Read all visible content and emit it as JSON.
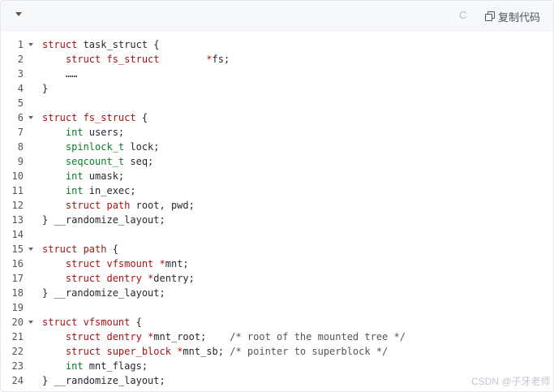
{
  "toolbar": {
    "language_label": "C",
    "copy_label": "复制代码",
    "copy_icon": "copy-icon",
    "collapse_icon": "chevron-down-icon"
  },
  "code_lines": [
    {
      "n": "1",
      "fold": true,
      "parts": [
        {
          "t": "struct",
          "c": "kw"
        },
        {
          "t": " task_struct ",
          "c": ""
        },
        {
          "t": "{",
          "c": ""
        }
      ]
    },
    {
      "n": "2",
      "fold": false,
      "parts": [
        {
          "t": "    struct fs_struct",
          "c": "kw"
        },
        {
          "t": "        ",
          "c": ""
        },
        {
          "t": "*",
          "c": "ptr"
        },
        {
          "t": "fs;",
          "c": ""
        }
      ]
    },
    {
      "n": "3",
      "fold": false,
      "parts": [
        {
          "t": "    ……",
          "c": ""
        }
      ]
    },
    {
      "n": "4",
      "fold": false,
      "parts": [
        {
          "t": "}",
          "c": ""
        }
      ]
    },
    {
      "n": "5",
      "fold": false,
      "parts": [
        {
          "t": "",
          "c": ""
        }
      ]
    },
    {
      "n": "6",
      "fold": true,
      "parts": [
        {
          "t": "struct fs_struct",
          "c": "kw"
        },
        {
          "t": " {",
          "c": ""
        }
      ]
    },
    {
      "n": "7",
      "fold": false,
      "parts": [
        {
          "t": "    int",
          "c": "ty"
        },
        {
          "t": " users;",
          "c": ""
        }
      ]
    },
    {
      "n": "8",
      "fold": false,
      "parts": [
        {
          "t": "    spinlock_t",
          "c": "ty"
        },
        {
          "t": " lock;",
          "c": ""
        }
      ]
    },
    {
      "n": "9",
      "fold": false,
      "parts": [
        {
          "t": "    seqcount_t",
          "c": "ty"
        },
        {
          "t": " seq;",
          "c": ""
        }
      ]
    },
    {
      "n": "10",
      "fold": false,
      "parts": [
        {
          "t": "    int",
          "c": "ty"
        },
        {
          "t": " umask;",
          "c": ""
        }
      ]
    },
    {
      "n": "11",
      "fold": false,
      "parts": [
        {
          "t": "    int",
          "c": "ty"
        },
        {
          "t": " in_exec;",
          "c": ""
        }
      ]
    },
    {
      "n": "12",
      "fold": false,
      "parts": [
        {
          "t": "    struct path",
          "c": "kw"
        },
        {
          "t": " root, pwd;",
          "c": ""
        }
      ]
    },
    {
      "n": "13",
      "fold": false,
      "parts": [
        {
          "t": "} __randomize_layout;",
          "c": ""
        }
      ]
    },
    {
      "n": "14",
      "fold": false,
      "parts": [
        {
          "t": "",
          "c": ""
        }
      ]
    },
    {
      "n": "15",
      "fold": true,
      "parts": [
        {
          "t": "struct path",
          "c": "kw"
        },
        {
          "t": " {",
          "c": ""
        }
      ]
    },
    {
      "n": "16",
      "fold": false,
      "parts": [
        {
          "t": "    struct vfsmount",
          "c": "kw"
        },
        {
          "t": " ",
          "c": ""
        },
        {
          "t": "*",
          "c": "ptr"
        },
        {
          "t": "mnt;",
          "c": ""
        }
      ]
    },
    {
      "n": "17",
      "fold": false,
      "parts": [
        {
          "t": "    struct dentry",
          "c": "kw"
        },
        {
          "t": " ",
          "c": ""
        },
        {
          "t": "*",
          "c": "ptr"
        },
        {
          "t": "dentry;",
          "c": ""
        }
      ]
    },
    {
      "n": "18",
      "fold": false,
      "parts": [
        {
          "t": "} __randomize_layout;",
          "c": ""
        }
      ]
    },
    {
      "n": "19",
      "fold": false,
      "parts": [
        {
          "t": "",
          "c": ""
        }
      ]
    },
    {
      "n": "20",
      "fold": true,
      "parts": [
        {
          "t": "struct vfsmount",
          "c": "kw"
        },
        {
          "t": " {",
          "c": ""
        }
      ]
    },
    {
      "n": "21",
      "fold": false,
      "parts": [
        {
          "t": "    struct dentry",
          "c": "kw"
        },
        {
          "t": " ",
          "c": ""
        },
        {
          "t": "*",
          "c": "ptr"
        },
        {
          "t": "mnt_root;    ",
          "c": ""
        },
        {
          "t": "/* root of the mounted tree */",
          "c": "cm"
        }
      ]
    },
    {
      "n": "22",
      "fold": false,
      "parts": [
        {
          "t": "    struct super_block",
          "c": "kw"
        },
        {
          "t": " ",
          "c": ""
        },
        {
          "t": "*",
          "c": "ptr"
        },
        {
          "t": "mnt_sb; ",
          "c": ""
        },
        {
          "t": "/* pointer to superblock */",
          "c": "cm"
        }
      ]
    },
    {
      "n": "23",
      "fold": false,
      "parts": [
        {
          "t": "    int",
          "c": "ty"
        },
        {
          "t": " mnt_flags;",
          "c": ""
        }
      ]
    },
    {
      "n": "24",
      "fold": false,
      "parts": [
        {
          "t": "} __randomize_layout;",
          "c": ""
        }
      ]
    }
  ],
  "watermark": "CSDN @子牙老师"
}
